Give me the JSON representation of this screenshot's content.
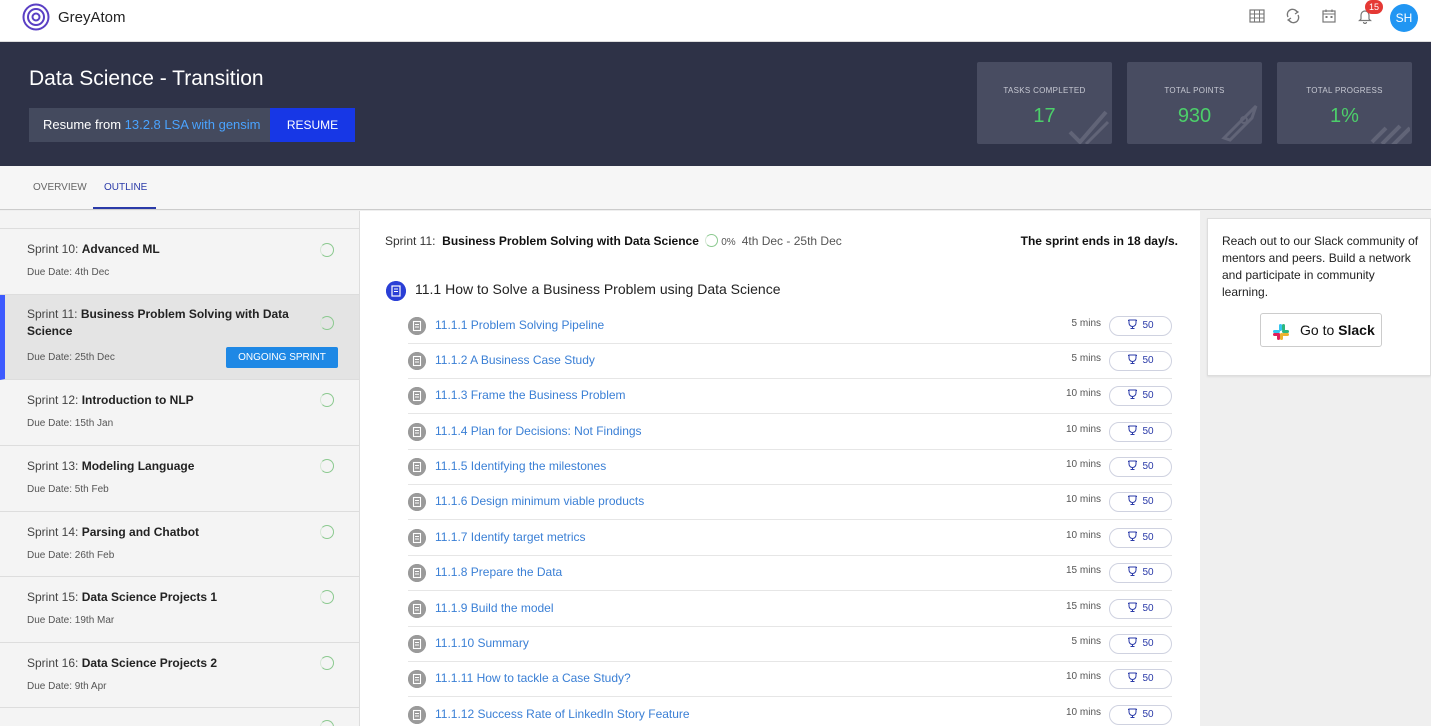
{
  "app": {
    "name": "GreyAtom",
    "notification_count": "15",
    "avatar_initials": "SH"
  },
  "hero": {
    "title": "Data Science - Transition",
    "resume_prefix": "Resume from ",
    "resume_link": "13.2.8 LSA with gensim",
    "resume_button": "RESUME",
    "stats": [
      {
        "label": "TASKS COMPLETED",
        "value": "17"
      },
      {
        "label": "TOTAL POINTS",
        "value": "930"
      },
      {
        "label": "TOTAL PROGRESS",
        "value": "1%"
      }
    ]
  },
  "tabs": [
    {
      "label": "OVERVIEW"
    },
    {
      "label": "OUTLINE"
    }
  ],
  "sidebar": {
    "sprints": [
      {
        "prefix": "Sprint 10: ",
        "name": "Advanced ML",
        "due": "Due Date: 4th Dec"
      },
      {
        "prefix": "Sprint 11: ",
        "name": "Business Problem Solving with Data Science",
        "due": "Due Date: 25th Dec",
        "badge": "ONGOING SPRINT"
      },
      {
        "prefix": "Sprint 12: ",
        "name": "Introduction to NLP",
        "due": "Due Date: 15th Jan"
      },
      {
        "prefix": "Sprint 13: ",
        "name": "Modeling Language",
        "due": "Due Date: 5th Feb"
      },
      {
        "prefix": "Sprint 14: ",
        "name": "Parsing and Chatbot",
        "due": "Due Date: 26th Feb"
      },
      {
        "prefix": "Sprint 15: ",
        "name": "Data Science Projects 1",
        "due": "Due Date: 19th Mar"
      },
      {
        "prefix": "Sprint 16: ",
        "name": "Data Science Projects 2",
        "due": "Due Date: 9th Apr"
      }
    ]
  },
  "main": {
    "sprint_prefix": "Sprint 11:",
    "sprint_name": "Business Problem Solving with Data Science",
    "sprint_progress": "0%",
    "sprint_dates": "4th Dec - 25th Dec",
    "sprint_ends": "The sprint ends in 18 day/s.",
    "module_title": "11.1 How to Solve a Business Problem using Data Science",
    "lessons": [
      {
        "title": "11.1.1 Problem Solving Pipeline",
        "mins": "5 mins",
        "points": "50"
      },
      {
        "title": "11.1.2 A Business Case Study",
        "mins": "5 mins",
        "points": "50"
      },
      {
        "title": "11.1.3 Frame the Business Problem",
        "mins": "10 mins",
        "points": "50"
      },
      {
        "title": "11.1.4 Plan for Decisions: Not Findings",
        "mins": "10 mins",
        "points": "50"
      },
      {
        "title": "11.1.5 Identifying the milestones",
        "mins": "10 mins",
        "points": "50"
      },
      {
        "title": "11.1.6 Design minimum viable products",
        "mins": "10 mins",
        "points": "50"
      },
      {
        "title": "11.1.7 Identify target metrics",
        "mins": "10 mins",
        "points": "50"
      },
      {
        "title": "11.1.8 Prepare the Data",
        "mins": "15 mins",
        "points": "50"
      },
      {
        "title": "11.1.9 Build the model",
        "mins": "15 mins",
        "points": "50"
      },
      {
        "title": "11.1.10 Summary",
        "mins": "5 mins",
        "points": "50"
      },
      {
        "title": "11.1.11 How to tackle a Case Study?",
        "mins": "10 mins",
        "points": "50"
      },
      {
        "title": "11.1.12 Success Rate of LinkedIn Story Feature",
        "mins": "10 mins",
        "points": "50"
      }
    ]
  },
  "slack": {
    "text": "Reach out to our Slack community of mentors and peers. Build a network and participate in community learning.",
    "button_prefix": "Go to ",
    "button_brand": "Slack"
  },
  "colors": {
    "accent": "#1737e6",
    "hero_bg": "#2e3247",
    "stat_value": "#4ccf6a",
    "link": "#3a7fd5"
  },
  "icons": [
    "apps-icon",
    "sync-icon",
    "calendar-icon",
    "bell-icon",
    "document-icon",
    "trophy-icon",
    "slack-icon"
  ]
}
